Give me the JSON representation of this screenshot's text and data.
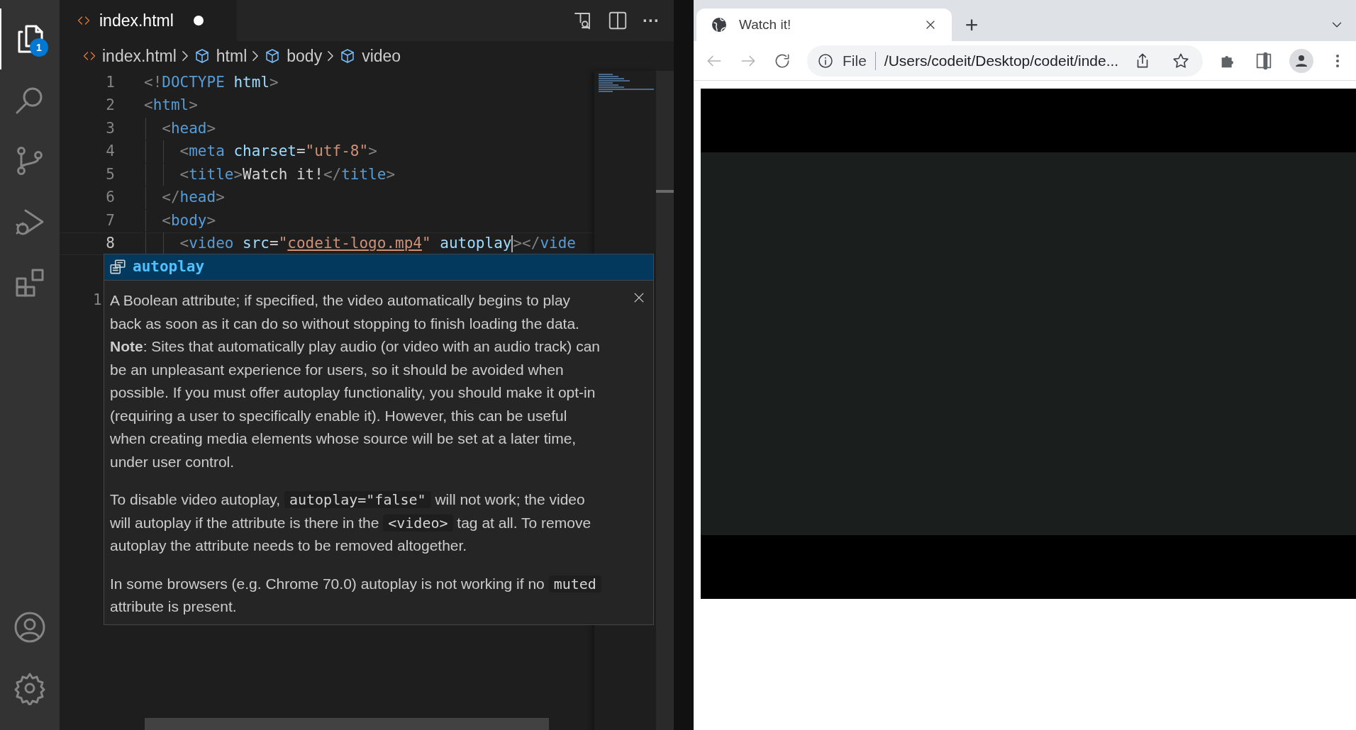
{
  "activity_bar": {
    "items": [
      {
        "kind": "files",
        "selected": true,
        "badge": "1"
      },
      {
        "kind": "search",
        "selected": false
      },
      {
        "kind": "source-control",
        "selected": false
      },
      {
        "kind": "run-debug",
        "selected": false
      },
      {
        "kind": "extensions",
        "selected": false
      }
    ],
    "bottom_items": [
      {
        "kind": "account"
      },
      {
        "kind": "settings"
      }
    ]
  },
  "editor": {
    "tab": {
      "label": "index.html",
      "modified": true
    },
    "actions": [
      {
        "kind": "preview"
      },
      {
        "kind": "split"
      },
      {
        "kind": "more",
        "label": "···"
      }
    ],
    "breadcrumb": [
      {
        "kind": "file",
        "label": "index.html"
      },
      {
        "kind": "element",
        "label": "html"
      },
      {
        "kind": "element",
        "label": "body"
      },
      {
        "kind": "element",
        "label": "video"
      }
    ],
    "lines": [
      {
        "number": "1",
        "current": false,
        "tokens": [
          {
            "kind": "punct",
            "text": "<!"
          },
          {
            "kind": "tag",
            "text": "DOCTYPE"
          },
          {
            "kind": "attr",
            "text": " html"
          },
          {
            "kind": "punct",
            "text": ">"
          }
        ]
      },
      {
        "number": "2",
        "current": false,
        "tokens": [
          {
            "kind": "punct",
            "text": "<"
          },
          {
            "kind": "tag",
            "text": "html"
          },
          {
            "kind": "punct",
            "text": ">"
          }
        ]
      },
      {
        "number": "3",
        "current": false,
        "tokens": [
          {
            "kind": "punct",
            "text": "  <"
          },
          {
            "kind": "tag",
            "text": "head"
          },
          {
            "kind": "punct",
            "text": ">"
          }
        ]
      },
      {
        "number": "4",
        "current": false,
        "tokens": [
          {
            "kind": "punct",
            "text": "    <"
          },
          {
            "kind": "tag",
            "text": "meta"
          },
          {
            "kind": "attr",
            "text": " charset"
          },
          {
            "kind": "text",
            "text": "="
          },
          {
            "kind": "string",
            "text": "\"utf-8\""
          },
          {
            "kind": "punct",
            "text": ">"
          }
        ]
      },
      {
        "number": "5",
        "current": false,
        "tokens": [
          {
            "kind": "punct",
            "text": "    <"
          },
          {
            "kind": "tag",
            "text": "title"
          },
          {
            "kind": "punct",
            "text": ">"
          },
          {
            "kind": "text",
            "text": "Watch it!"
          },
          {
            "kind": "punct",
            "text": "</"
          },
          {
            "kind": "tag",
            "text": "title"
          },
          {
            "kind": "punct",
            "text": ">"
          }
        ]
      },
      {
        "number": "6",
        "current": false,
        "tokens": [
          {
            "kind": "punct",
            "text": "  </"
          },
          {
            "kind": "tag",
            "text": "head"
          },
          {
            "kind": "punct",
            "text": ">"
          }
        ]
      },
      {
        "number": "7",
        "current": false,
        "tokens": [
          {
            "kind": "punct",
            "text": "  <"
          },
          {
            "kind": "tag",
            "text": "body"
          },
          {
            "kind": "punct",
            "text": ">"
          }
        ]
      },
      {
        "number": "8",
        "current": true,
        "tokens": [
          {
            "kind": "punct",
            "text": "    <"
          },
          {
            "kind": "tag",
            "text": "video"
          },
          {
            "kind": "attr",
            "text": " src"
          },
          {
            "kind": "text",
            "text": "="
          },
          {
            "kind": "string",
            "text": "\""
          },
          {
            "kind": "link",
            "text": "codeit-logo.mp4"
          },
          {
            "kind": "string",
            "text": "\""
          },
          {
            "kind": "attr",
            "text": " autoplay"
          },
          {
            "kind": "cursor"
          },
          {
            "kind": "punct",
            "text": "></"
          },
          {
            "kind": "tag",
            "text": "vide"
          }
        ]
      }
    ],
    "partial_line_number": "1",
    "suggestion": {
      "label": "autoplay",
      "selected": true
    },
    "doc": {
      "paragraphs": [
        [
          {
            "kind": "text",
            "text": "A Boolean attribute; if specified, the video automatically begins to play back as soon as it can do so without stopping to finish loading the data. **Note**: Sites that automatically play audio (or video with an audio track) can be an unpleasant experience for users, so it should be avoided when possible. If you must offer autoplay functionality, you should make it opt-in (requiring a user to specifically enable it). However, this can be useful when creating media elements whose source will be set at a later time, under user control."
          }
        ],
        [
          {
            "kind": "text",
            "text": "To disable video autoplay, "
          },
          {
            "kind": "code",
            "text": "autoplay=\"false\""
          },
          {
            "kind": "text",
            "text": " will not work; the video will autoplay if the attribute is there in the "
          },
          {
            "kind": "code",
            "text": "<video>"
          },
          {
            "kind": "text",
            "text": " tag at all. To remove autoplay the attribute needs to be removed altogether."
          }
        ],
        [
          {
            "kind": "text",
            "text": "In some browsers (e.g. Chrome 70.0) autoplay is not working if no "
          },
          {
            "kind": "code",
            "text": "muted"
          },
          {
            "kind": "text",
            "text": " attribute is present."
          }
        ]
      ]
    }
  },
  "browser": {
    "tab": {
      "title": "Watch it!",
      "selected": true
    },
    "new_tab": "+",
    "address": {
      "scheme": "File",
      "url": "/Users/codeit/Desktop/codeit/inde..."
    },
    "back_enabled": false,
    "forward_enabled": false,
    "content": {
      "kind": "video"
    }
  }
}
